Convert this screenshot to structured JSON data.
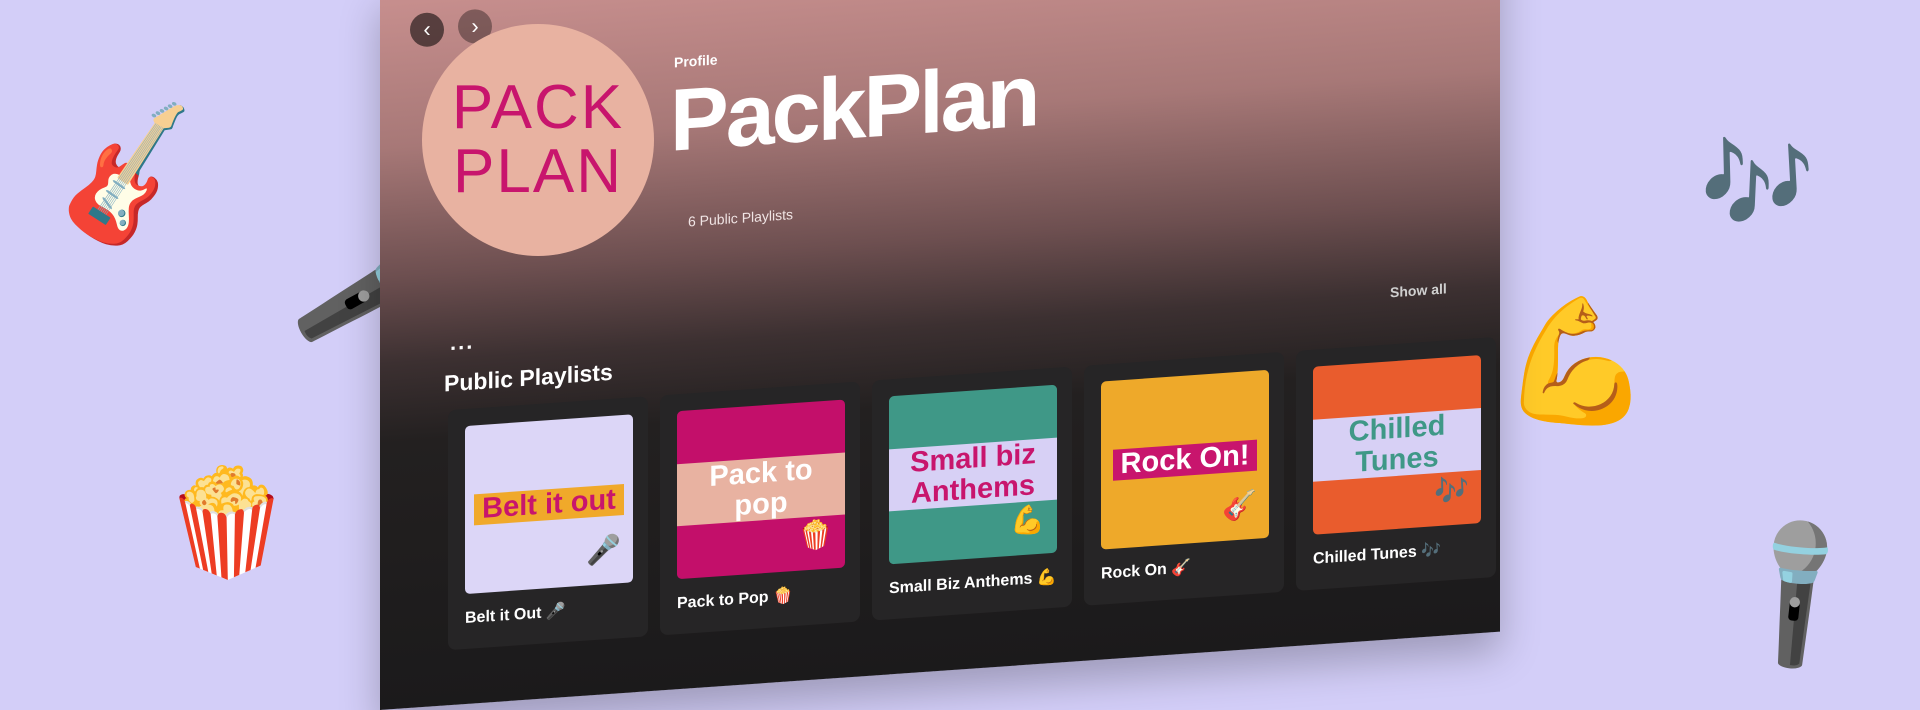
{
  "profile": {
    "label": "Profile",
    "name": "PackPlan",
    "avatar_text": "PACK\nPLAN",
    "playlist_count": "6 Public Playlists"
  },
  "navigation": {
    "back_icon": "chevron-left-icon",
    "forward_icon": "chevron-right-icon"
  },
  "section": {
    "more_label": "...",
    "title": "Public Playlists",
    "show_all": "Show all"
  },
  "playlists": [
    {
      "cover_text": "Belt it out",
      "cover_emoji": "🎤",
      "title": "Belt it Out 🎤"
    },
    {
      "cover_text": "Pack to pop",
      "cover_emoji": "🍿",
      "title": "Pack to Pop 🍿"
    },
    {
      "cover_text": "Small biz Anthems",
      "cover_emoji": "💪",
      "title": "Small Biz Anthems 💪"
    },
    {
      "cover_text": "Rock On!",
      "cover_emoji": "🎸",
      "title": "Rock On 🎸"
    },
    {
      "cover_text": "Chilled Tunes",
      "cover_emoji": "🎶",
      "title": "Chilled Tunes 🎶"
    }
  ],
  "decorations": {
    "guitar": "🎸",
    "microphone_left": "🎤",
    "popcorn": "🍿",
    "music_notes": "🎶",
    "muscle": "💪",
    "microphone_right": "🎤"
  },
  "colors": {
    "background": "#d3cef8",
    "brand_pink": "#c8156d",
    "avatar_bg": "#e8b2a1",
    "card_bg": "#262526"
  }
}
